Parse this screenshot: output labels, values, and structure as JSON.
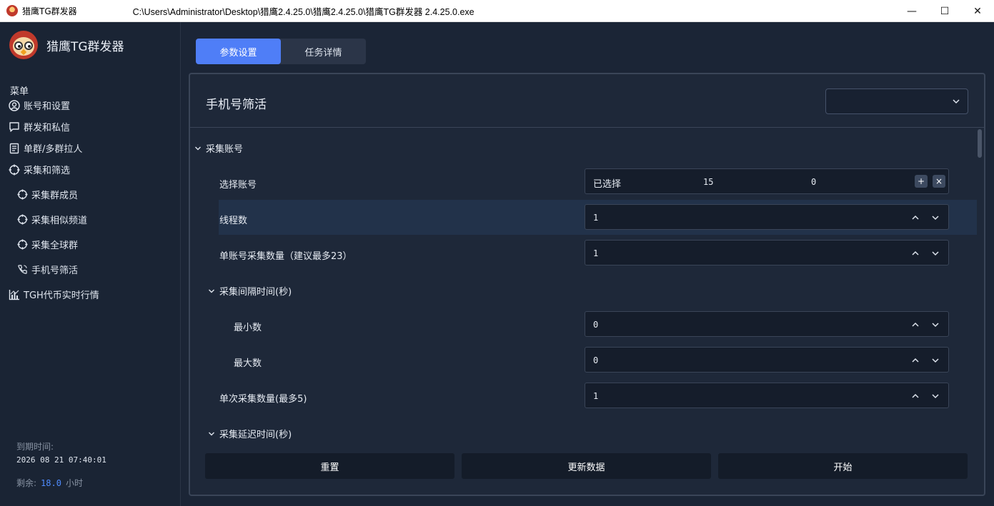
{
  "window": {
    "app_name": "猎鹰TG群发器",
    "path": "C:\\Users\\Administrator\\Desktop\\猎鹰2.4.25.0\\猎鹰2.4.25.0\\猎鹰TG群发器 2.4.25.0.exe",
    "minimize": "—",
    "maximize": "☐",
    "close": "✕"
  },
  "brand": {
    "name": "猎鹰TG群发器"
  },
  "sidebar": {
    "menu_title": "菜单",
    "items": [
      {
        "label": "账号和设置",
        "icon": "user-circle-icon"
      },
      {
        "label": "群发和私信",
        "icon": "chat-bubble-icon"
      },
      {
        "label": "单群/多群拉人",
        "icon": "document-icon"
      },
      {
        "label": "采集和筛选",
        "icon": "crosshair-icon"
      },
      {
        "label": "采集群成员",
        "icon": "crosshair-icon"
      },
      {
        "label": "采集相似频道",
        "icon": "crosshair-icon"
      },
      {
        "label": "采集全球群",
        "icon": "crosshair-icon"
      },
      {
        "label": "手机号筛活",
        "icon": "phone-icon"
      },
      {
        "label": "TGH代币实时行情",
        "icon": "bar-chart-icon"
      }
    ],
    "expire_label": "到期时间:",
    "expire_date": "2026 08 21 07:40:01",
    "remain_label": "剩余:",
    "remain_value": "18.0",
    "remain_unit": "小时"
  },
  "tabs": [
    {
      "label": "参数设置",
      "active": true
    },
    {
      "label": "任务详情",
      "active": false
    }
  ],
  "panel": {
    "title": "手机号筛活",
    "select_value": "",
    "section_collect_account": "采集账号",
    "select_account_label": "选择账号",
    "selected_text": "已选择",
    "selected_count": "15",
    "selected_other": "0",
    "add_btn": "+",
    "remove_btn": "×",
    "threads_label": "线程数",
    "threads_value": "1",
    "per_account_label": "单账号采集数量（建议最多23）",
    "per_account_value": "1",
    "interval_section": "采集间隔时间(秒)",
    "min_label": "最小数",
    "min_value": "0",
    "max_label": "最大数",
    "max_value": "0",
    "single_batch_label": "单次采集数量(最多5)",
    "single_batch_value": "1",
    "delay_section": "采集延迟时间(秒)"
  },
  "buttons": {
    "reset": "重置",
    "update": "更新数据",
    "start": "开始"
  },
  "colors": {
    "accent": "#4f7ef7",
    "background": "#1b2536",
    "highlight_row": "#22324a"
  }
}
